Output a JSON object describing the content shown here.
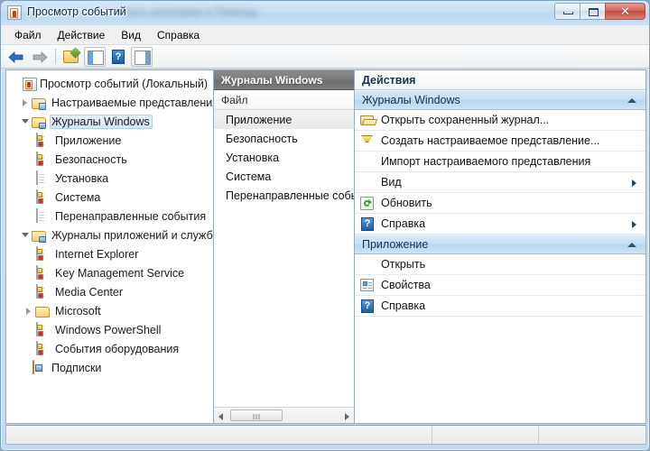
{
  "window": {
    "title": "Просмотр событий",
    "subtitle_blurred": "путь категории и Помощь",
    "icon": "event-viewer-icon",
    "buttons": {
      "minimize": "minimize-icon",
      "maximize": "maximize-icon",
      "close": "✕"
    }
  },
  "menubar": {
    "items": [
      {
        "label": "Файл"
      },
      {
        "label": "Действие"
      },
      {
        "label": "Вид"
      },
      {
        "label": "Справка"
      }
    ]
  },
  "toolbar": {
    "items": [
      {
        "name": "back-arrow-icon",
        "label": "Назад"
      },
      {
        "name": "forward-arrow-icon",
        "label": "Вперед"
      },
      {
        "name": "new-view-folder-icon",
        "label": "Создать представление"
      },
      {
        "name": "show-hide-tree-icon",
        "label": "Дерево консоли"
      },
      {
        "name": "help-icon",
        "label": "Справка"
      },
      {
        "name": "show-hide-actions-icon",
        "label": "Панель действий"
      }
    ],
    "help_glyph": "?"
  },
  "tree": {
    "items": [
      {
        "label": "Просмотр событий (Локальный)",
        "icon": "event-viewer-root-icon",
        "indent": 0,
        "expander": "none",
        "selected": false
      },
      {
        "label": "Настраиваемые представления",
        "icon": "custom-views-folder-icon",
        "indent": 1,
        "expander": "closed",
        "selected": false
      },
      {
        "label": "Журналы Windows",
        "icon": "windows-logs-folder-icon",
        "indent": 1,
        "expander": "open",
        "selected": true
      },
      {
        "label": "Приложение",
        "icon": "event-log-icon",
        "indent": 2,
        "expander": "none",
        "selected": false
      },
      {
        "label": "Безопасность",
        "icon": "event-log-icon",
        "indent": 2,
        "expander": "none",
        "selected": false
      },
      {
        "label": "Установка",
        "icon": "log-page-icon",
        "indent": 2,
        "expander": "none",
        "selected": false
      },
      {
        "label": "Система",
        "icon": "event-log-icon",
        "indent": 2,
        "expander": "none",
        "selected": false
      },
      {
        "label": "Перенаправленные события",
        "icon": "log-page-icon",
        "indent": 2,
        "expander": "none",
        "selected": false
      },
      {
        "label": "Журналы приложений и служб",
        "icon": "app-logs-folder-icon",
        "indent": 1,
        "expander": "open",
        "selected": false
      },
      {
        "label": "Internet Explorer",
        "icon": "event-log-icon",
        "indent": 2,
        "expander": "none",
        "selected": false
      },
      {
        "label": "Key Management Service",
        "icon": "event-log-icon",
        "indent": 2,
        "expander": "none",
        "selected": false
      },
      {
        "label": "Media Center",
        "icon": "event-log-icon",
        "indent": 2,
        "expander": "none",
        "selected": false
      },
      {
        "label": "Microsoft",
        "icon": "folder-icon",
        "indent": 2,
        "expander": "closed",
        "selected": false
      },
      {
        "label": "Windows PowerShell",
        "icon": "event-log-icon",
        "indent": 2,
        "expander": "none",
        "selected": false
      },
      {
        "label": "События оборудования",
        "icon": "event-log-icon",
        "indent": 2,
        "expander": "none",
        "selected": false
      },
      {
        "label": "Подписки",
        "icon": "subscriptions-icon",
        "indent": 1,
        "expander": "none",
        "selected": false
      }
    ]
  },
  "list_pane": {
    "header": "Журналы Windows",
    "column_header": "Файл",
    "rows": [
      {
        "label": "Приложение",
        "selected": true
      },
      {
        "label": "Безопасность",
        "selected": false
      },
      {
        "label": "Установка",
        "selected": false
      },
      {
        "label": "Система",
        "selected": false
      },
      {
        "label": "Перенаправленные собы",
        "selected": false
      }
    ],
    "scrollbar": {
      "left_arrow": "scroll-left-icon",
      "right_arrow": "scroll-right-icon"
    }
  },
  "actions_pane": {
    "title": "Действия",
    "groups": [
      {
        "header": "Журналы Windows",
        "collapse_icon": "chevron-up-icon",
        "items": [
          {
            "label": "Открыть сохраненный журнал...",
            "icon": "open-folder-icon",
            "submenu": false
          },
          {
            "label": "Создать настраиваемое представление...",
            "icon": "funnel-filter-icon",
            "submenu": false
          },
          {
            "label": "Импорт настраиваемого представления",
            "icon": "none",
            "submenu": false
          },
          {
            "label": "Вид",
            "icon": "none",
            "submenu": true
          },
          {
            "label": "Обновить",
            "icon": "refresh-icon",
            "submenu": false
          },
          {
            "label": "Справка",
            "icon": "help-icon",
            "submenu": true
          }
        ]
      },
      {
        "header": "Приложение",
        "collapse_icon": "chevron-up-icon",
        "items": [
          {
            "label": "Открыть",
            "icon": "none",
            "submenu": false
          },
          {
            "label": "Свойства",
            "icon": "properties-icon",
            "submenu": false
          },
          {
            "label": "Справка",
            "icon": "help-icon",
            "submenu": false
          }
        ]
      }
    ],
    "help_glyph": "?"
  },
  "statusbar": {
    "cells": [
      "",
      "",
      ""
    ]
  },
  "colors": {
    "title_bar": "#c6dcf2",
    "accent_header": "#c5ddf3",
    "gray_header": "#7a7a7a",
    "close_button": "#c24a40",
    "window_border": "#7ba0c0"
  }
}
